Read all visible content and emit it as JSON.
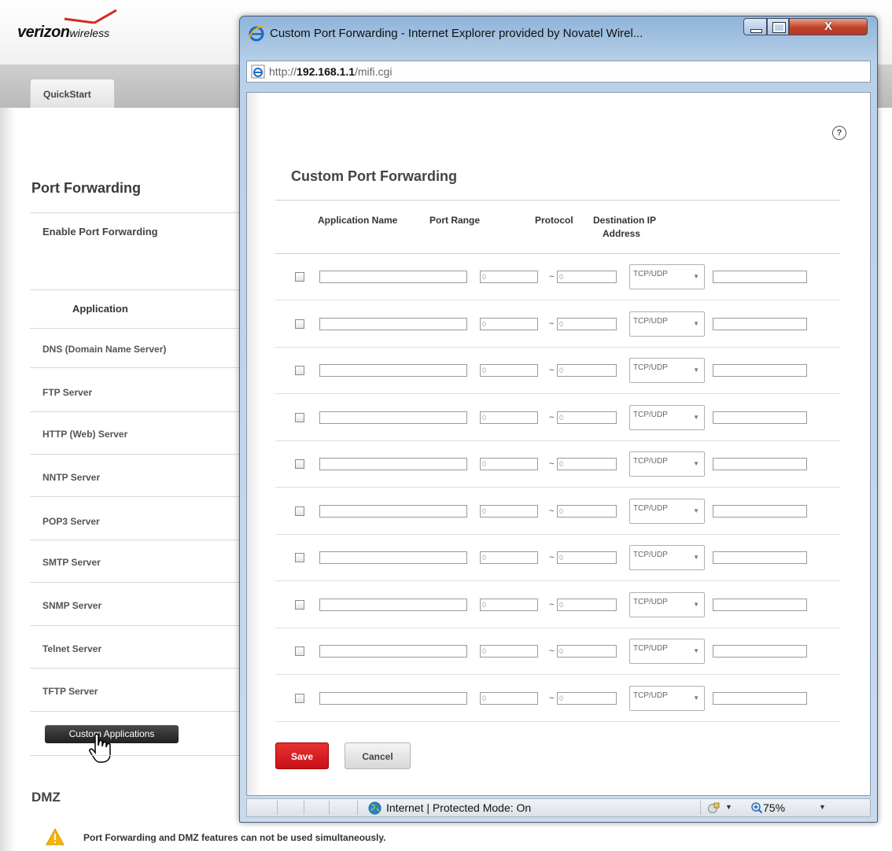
{
  "background": {
    "logo": {
      "brand": "verizon",
      "suffix": "wireless"
    },
    "tab_quickstart": "QuickStart",
    "section_title": "Port Forwarding",
    "enable_label": "Enable Port Forwarding",
    "application_header": "Application",
    "applications": [
      "DNS (Domain Name Server)",
      "FTP Server",
      "HTTP (Web) Server",
      "NNTP Server",
      "POP3 Server",
      "SMTP Server",
      "SNMP Server",
      "Telnet Server",
      "TFTP Server"
    ],
    "custom_apps_button": "Custom Applications",
    "dmz_title": "DMZ",
    "warning_text": "Port Forwarding and DMZ features can not be used simultaneously."
  },
  "window": {
    "title": "Custom Port Forwarding - Internet Explorer provided by Novatel Wirel...",
    "close_label": "X",
    "address": {
      "scheme": "http://",
      "host": "192.168.1.1",
      "path": "/mifi.cgi"
    }
  },
  "dialog": {
    "help": "?",
    "title": "Custom Port Forwarding",
    "columns": {
      "app_name": "Application Name",
      "port_range": "Port Range",
      "protocol": "Protocol",
      "destination_ip": "Destination IP",
      "destination_ip_2": "Address"
    },
    "rows": [
      {
        "app": "",
        "port_start": "0",
        "port_end": "0",
        "protocol": "TCP/UDP",
        "ip": ""
      },
      {
        "app": "",
        "port_start": "0",
        "port_end": "0",
        "protocol": "TCP/UDP",
        "ip": ""
      },
      {
        "app": "",
        "port_start": "0",
        "port_end": "0",
        "protocol": "TCP/UDP",
        "ip": ""
      },
      {
        "app": "",
        "port_start": "0",
        "port_end": "0",
        "protocol": "TCP/UDP",
        "ip": ""
      },
      {
        "app": "",
        "port_start": "0",
        "port_end": "0",
        "protocol": "TCP/UDP",
        "ip": ""
      },
      {
        "app": "",
        "port_start": "0",
        "port_end": "0",
        "protocol": "TCP/UDP",
        "ip": ""
      },
      {
        "app": "",
        "port_start": "0",
        "port_end": "0",
        "protocol": "TCP/UDP",
        "ip": ""
      },
      {
        "app": "",
        "port_start": "0",
        "port_end": "0",
        "protocol": "TCP/UDP",
        "ip": ""
      },
      {
        "app": "",
        "port_start": "0",
        "port_end": "0",
        "protocol": "TCP/UDP",
        "ip": ""
      },
      {
        "app": "",
        "port_start": "0",
        "port_end": "0",
        "protocol": "TCP/UDP",
        "ip": ""
      }
    ],
    "range_separator": "~",
    "save": "Save",
    "cancel": "Cancel"
  },
  "status_bar": {
    "zone": "Internet | Protected Mode: On",
    "zoom": "75%"
  },
  "colors": {
    "save_red": "#d71f24",
    "window_frame": "#b9d1ea",
    "close_red": "#c24128"
  },
  "icons": [
    "verizon-check-icon",
    "ie-logo-icon",
    "help-icon",
    "globe-icon",
    "security-icon",
    "zoom-icon",
    "hand-cursor-icon",
    "warning-icon"
  ]
}
